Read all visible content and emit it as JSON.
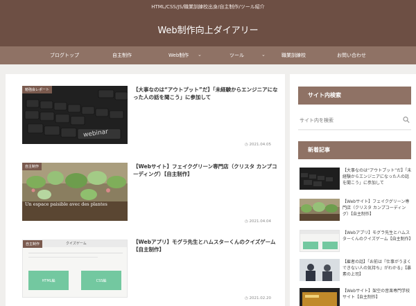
{
  "header": {
    "tagline": "HTML/CSS/JS/職業訓練校出身/自主制作/ツール紹介",
    "site_title": "Web制作向上ダイアリー"
  },
  "nav": {
    "items": [
      {
        "label": "ブログトップ"
      },
      {
        "label": "自主制作"
      },
      {
        "label": "Web制作",
        "caret": "⌄"
      },
      {
        "label": "ツール",
        "caret": "⌄"
      },
      {
        "label": "職業訓練校"
      },
      {
        "label": "お問い合わせ"
      }
    ]
  },
  "posts": [
    {
      "tag": "勉強会レポート",
      "thumb_text": "webinar",
      "title": "【大事なのは“アウトプット”だ】「未経験からエンジニアになった人の話を聞こう」に参加して",
      "date": "2021.04.05"
    },
    {
      "tag": "自主制作",
      "thumb_text": "Un espace paisible avec des plantes",
      "title": "【Webサイト】フェイクグリーン専門店（クリスタ カンプコーディング）【自主制作】",
      "date": "2021.04.04"
    },
    {
      "tag": "自主制作",
      "thumb_header": "クイズゲーム",
      "thumb_btn1": "HTML編",
      "thumb_btn2": "CSS編",
      "title": "【Webアプリ】モグラ先生とハムスターくんのクイズゲーム【自主制作】",
      "date": "2021.02.20"
    }
  ],
  "sidebar": {
    "search_heading": "サイト内検索",
    "search_placeholder": "サイト内を検索",
    "recent_heading": "新着記事",
    "recent": [
      {
        "title": "【大事なのは“アウトプット”だ】「未経験からエンジニアになった人の話を聞こう」に参加して"
      },
      {
        "title": "【Webサイト】フェイクグリーン専門店（クリスタ カンプコーディング）【自主制作】"
      },
      {
        "title": "【Webアプリ】モグラ先生とハムスターくんのクイズゲーム【自主制作】"
      },
      {
        "title": "【雇者の話】「お前は『仕事がうまくできない人の気持ち』がわかる」【暴素の上司】"
      },
      {
        "title": "【Webサイト】架空の音楽専門学校サイト【自主制作】"
      }
    ]
  },
  "colors": {
    "header_bg": "#6d4f44",
    "nav_bg": "#8f7265",
    "accent": "#8f7265",
    "page_bg": "#f0efed"
  }
}
